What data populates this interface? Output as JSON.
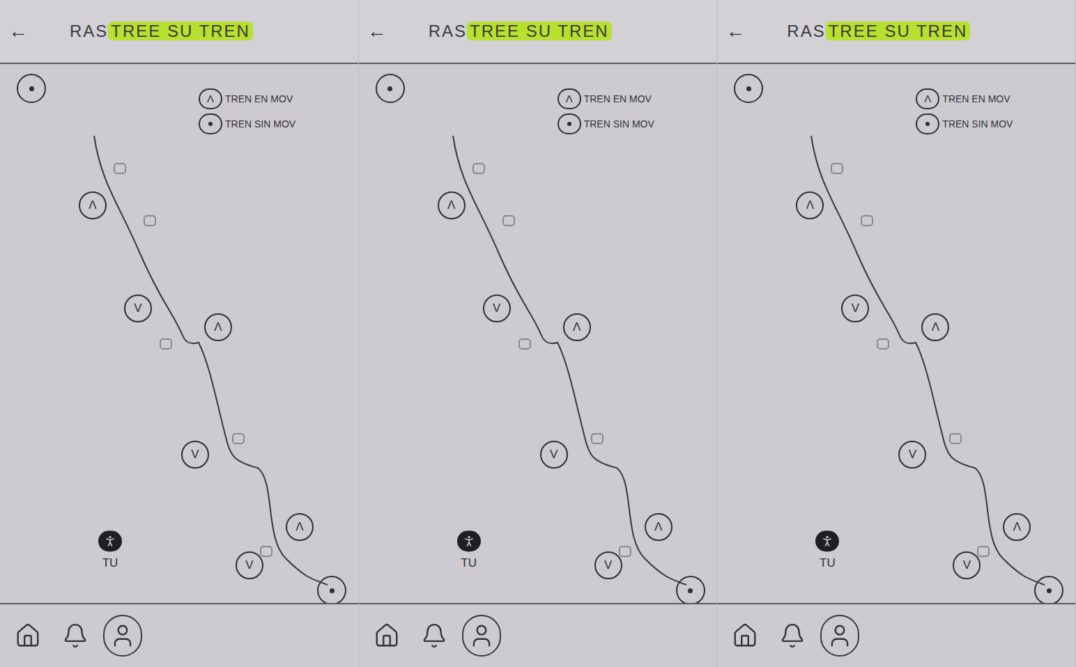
{
  "panels": [
    {
      "back": "←",
      "title": {
        "plain": "RAS",
        "highlighted": "TREE SU TREN"
      },
      "legend": [
        {
          "kind": "moving",
          "symbol": "Λ",
          "label": "TREN EN MOV"
        },
        {
          "kind": "stopped",
          "label": "TREN SIN MOV"
        }
      ],
      "markers": [
        {
          "kind": "stopped"
        },
        {
          "kind": "station"
        },
        {
          "kind": "up",
          "symbol": "Λ"
        },
        {
          "kind": "station"
        },
        {
          "kind": "down",
          "symbol": "V"
        },
        {
          "kind": "station"
        },
        {
          "kind": "up",
          "symbol": "Λ"
        },
        {
          "kind": "station"
        },
        {
          "kind": "down",
          "symbol": "V"
        },
        {
          "kind": "up",
          "symbol": "Λ"
        },
        {
          "kind": "down",
          "symbol": "V"
        },
        {
          "kind": "station"
        },
        {
          "kind": "stopped"
        }
      ],
      "user": {
        "label": "TU"
      },
      "nav": [
        {
          "kind": "home",
          "selected": false
        },
        {
          "kind": "alerts",
          "selected": false
        },
        {
          "kind": "profile",
          "selected": true
        }
      ]
    },
    {
      "back": "←",
      "title": {
        "plain": "RAS",
        "highlighted": "TREE SU TREN"
      },
      "legend": [
        {
          "kind": "moving",
          "symbol": "Λ",
          "label": "TREN EN MOV"
        },
        {
          "kind": "stopped",
          "label": "TREN SIN MOV"
        }
      ],
      "markers": [
        {
          "kind": "stopped"
        },
        {
          "kind": "station"
        },
        {
          "kind": "up",
          "symbol": "Λ"
        },
        {
          "kind": "station"
        },
        {
          "kind": "down",
          "symbol": "V"
        },
        {
          "kind": "station"
        },
        {
          "kind": "up",
          "symbol": "Λ"
        },
        {
          "kind": "station"
        },
        {
          "kind": "down",
          "symbol": "V"
        },
        {
          "kind": "up",
          "symbol": "Λ"
        },
        {
          "kind": "down",
          "symbol": "V"
        },
        {
          "kind": "station"
        },
        {
          "kind": "stopped"
        }
      ],
      "user": {
        "label": "TU"
      },
      "nav": [
        {
          "kind": "home",
          "selected": false
        },
        {
          "kind": "alerts",
          "selected": false
        },
        {
          "kind": "profile",
          "selected": true
        }
      ]
    },
    {
      "back": "←",
      "title": {
        "plain": "RAS",
        "highlighted": "TREE SU TREN"
      },
      "legend": [
        {
          "kind": "moving",
          "symbol": "Λ",
          "label": "TREN EN MOV"
        },
        {
          "kind": "stopped",
          "label": "TREN SIN MOV"
        }
      ],
      "markers": [
        {
          "kind": "stopped"
        },
        {
          "kind": "station"
        },
        {
          "kind": "up",
          "symbol": "Λ"
        },
        {
          "kind": "station"
        },
        {
          "kind": "down",
          "symbol": "V"
        },
        {
          "kind": "station"
        },
        {
          "kind": "up",
          "symbol": "Λ"
        },
        {
          "kind": "station"
        },
        {
          "kind": "down",
          "symbol": "V"
        },
        {
          "kind": "up",
          "symbol": "Λ"
        },
        {
          "kind": "down",
          "symbol": "V"
        },
        {
          "kind": "station"
        },
        {
          "kind": "stopped"
        }
      ],
      "user": {
        "label": "TU"
      },
      "nav": [
        {
          "kind": "home",
          "selected": false
        },
        {
          "kind": "alerts",
          "selected": false
        },
        {
          "kind": "profile",
          "selected": true
        }
      ]
    }
  ]
}
